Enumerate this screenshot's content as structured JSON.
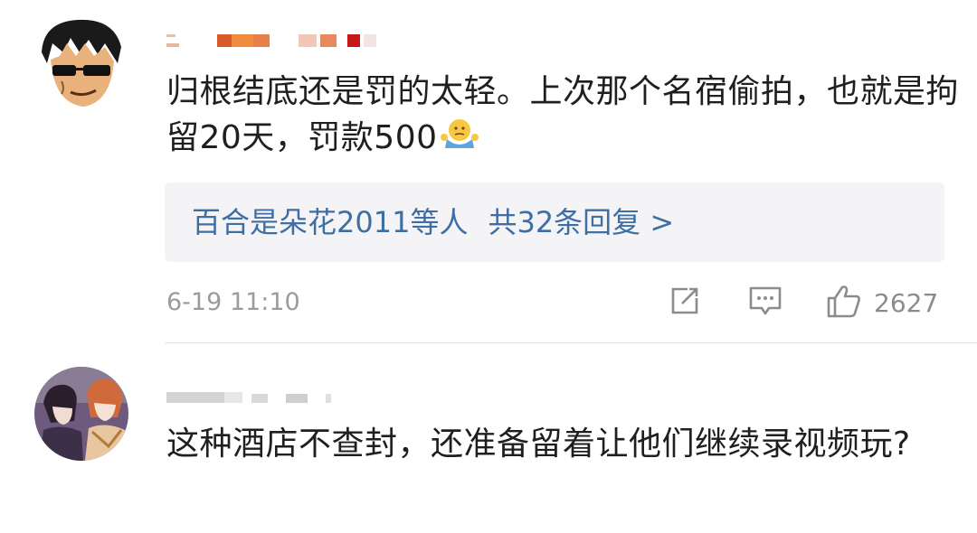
{
  "comments": [
    {
      "text": "归根结底还是罚的太轻。上次那个名宿偷拍，也就是拘留20天，罚款500",
      "emoji": "shrug-emoji",
      "replies": {
        "users": "百合是朵花2011等人",
        "count_label": "共32条回复 >"
      },
      "time": "6-19 11:10",
      "likes": "2627"
    },
    {
      "text": "这种酒店不查封，还准备留着让他们继续录视频玩?"
    }
  ],
  "colors": {
    "reply_link": "#3f6ea3",
    "meta_gray": "#9b9b9b",
    "reply_bg": "#f4f4f6"
  }
}
